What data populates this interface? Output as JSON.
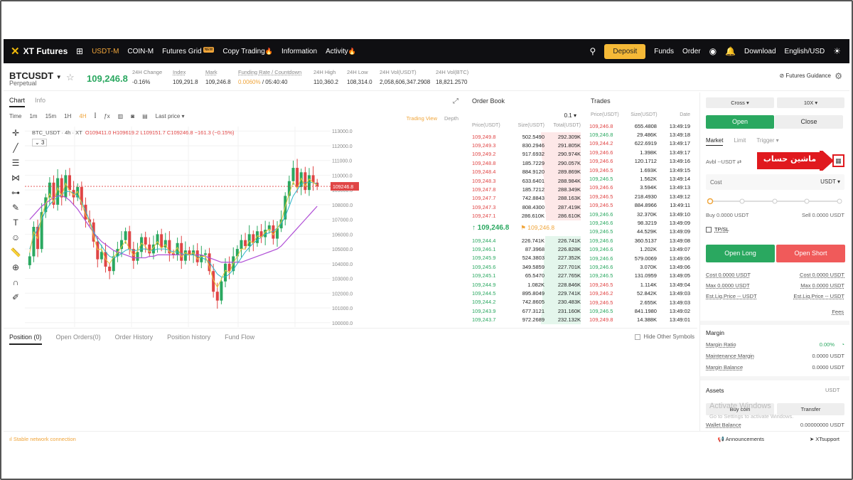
{
  "topnav": {
    "logo": "XT Futures",
    "items": [
      "USDT-M",
      "COIN-M",
      "Futures Grid",
      "Copy Trading",
      "Information",
      "Activity"
    ],
    "grid_badge": "NEW",
    "deposit": "Deposit",
    "funds": "Funds",
    "order": "Order",
    "download": "Download",
    "lang": "English/USD"
  },
  "header": {
    "symbol": "BTCUSDT",
    "type": "Perpetual",
    "last_price": "109,246.8",
    "stats": [
      {
        "label": "24H Change",
        "value": "-0.16%"
      },
      {
        "label": "Index",
        "value": "109,291.8"
      },
      {
        "label": "Mark",
        "value": "109,246.8"
      },
      {
        "label": "Funding Rate / Countdown",
        "value": "0.0060%",
        "value2": "05:40:40"
      },
      {
        "label": "24H High",
        "value": "110,360.2"
      },
      {
        "label": "24H Low",
        "value": "108,314.0"
      },
      {
        "label": "24H Vol(USDT)",
        "value": "2,058,606,347.2908"
      },
      {
        "label": "24H Vol(BTC)",
        "value": "18,821.2570"
      }
    ],
    "guidance": "Futures Guidance"
  },
  "chart": {
    "tabs": [
      "Chart",
      "Info"
    ],
    "intervals": [
      "Time",
      "1m",
      "15m",
      "1H",
      "4H"
    ],
    "last_price_label": "Last price",
    "view_tv": "Trading View",
    "view_depth": "Depth",
    "legend_title": "BTC_USDT · 4h · XT",
    "legend_values": "O109411.0 H109619.2 L109151.7 C109246.8 −161.3 (−0.15%)",
    "indicator_count": "3",
    "price_tag": "109246.8",
    "axis_labels": [
      "113000.0",
      "112000.0",
      "111000.0",
      "110000.0",
      "109000.0",
      "108000.0",
      "107000.0",
      "106000.0",
      "105000.0",
      "104000.0",
      "103000.0",
      "102000.0",
      "101000.0",
      "100000.0"
    ]
  },
  "chart_data": {
    "type": "candlestick",
    "title": "BTC_USDT · 4h · XT",
    "ylim": [
      99700,
      113300
    ],
    "closes": [
      104500,
      106500,
      105000,
      107500,
      108500,
      109500,
      108000,
      109800,
      108500,
      110000,
      109000,
      108500,
      109200,
      108000,
      107000,
      106800,
      105500,
      104300,
      104800,
      103800,
      103500,
      104500,
      105000,
      105600,
      106200,
      105000,
      104200,
      104800,
      105800,
      105300,
      104700,
      105300,
      106000,
      105100,
      105600,
      104700,
      104600,
      105400,
      104200,
      104900,
      104600,
      104900,
      104100,
      104600,
      104700,
      103500,
      102100,
      101500,
      102800,
      104000,
      103500,
      104500,
      105000,
      105600,
      105200,
      106000,
      105400,
      106200,
      105800,
      106300,
      106600,
      105700,
      106400,
      107000,
      108600,
      109600,
      110500,
      109200,
      110200,
      109000,
      110000,
      109500,
      109246.8
    ],
    "ma_fast": [
      105000,
      105800,
      106400,
      107000,
      107600,
      108000,
      108300,
      108500,
      108700,
      108900,
      108900,
      108800,
      108600,
      108200,
      107600,
      106900,
      106200,
      105600,
      105200,
      104800,
      104500,
      104400,
      104500,
      104700,
      104900,
      105000,
      104900,
      104900,
      105000,
      105000,
      104900,
      104900,
      105000,
      105000,
      105000,
      104900,
      104800,
      104800,
      104700,
      104600,
      104600,
      104600,
      104500,
      104400,
      104300,
      104100,
      103700,
      103300,
      103100,
      103100,
      103300,
      103600,
      104000,
      104400,
      104800,
      105100,
      105400,
      105600,
      105800,
      106000,
      106100,
      106200,
      106400,
      106700,
      107200,
      107900,
      108600,
      109000,
      109400,
      109500,
      109500,
      109500,
      109400
    ],
    "ma_slow": [
      107000,
      107300,
      107600,
      107900,
      108100,
      108300,
      108500,
      108600,
      108600,
      108500,
      108300,
      108000,
      107700,
      107300,
      106900,
      106500,
      106100,
      105800,
      105500,
      105300,
      105100,
      104900,
      104800,
      104700,
      104600,
      104500,
      104400,
      104400,
      104400,
      104400,
      104500,
      104500,
      104600,
      104600,
      104600,
      104600,
      104600,
      104600,
      104600,
      104600,
      104600,
      104600,
      104600,
      104600,
      104500,
      104400,
      104300,
      104200,
      104100,
      104100,
      104100,
      104100,
      104100,
      104100,
      104200,
      104300,
      104400,
      104500,
      104600,
      104700,
      104800,
      104900,
      105000,
      105200,
      105500,
      105800,
      106100,
      106400,
      106700,
      107000,
      107300,
      107600,
      107900
    ]
  },
  "orderbook": {
    "title": "Order Book",
    "precision": "0.1",
    "cols": [
      "Price(USDT)",
      "Size(USDT)",
      "Total(USDT)"
    ],
    "asks": [
      [
        "109,249.8",
        "502.5490",
        "292.309K"
      ],
      [
        "109,249.3",
        "830.2946",
        "291.805K"
      ],
      [
        "109,249.2",
        "917.6932",
        "290.974K"
      ],
      [
        "109,248.8",
        "185.7229",
        "290.057K"
      ],
      [
        "109,248.4",
        "884.9120",
        "289.869K"
      ],
      [
        "109,248.3",
        "633.6401",
        "288.984K"
      ],
      [
        "109,247.8",
        "185.7212",
        "288.349K"
      ],
      [
        "109,247.7",
        "742.8843",
        "288.163K"
      ],
      [
        "109,247.3",
        "808.4300",
        "287.419K"
      ],
      [
        "109,247.1",
        "286.610K",
        "286.610K"
      ]
    ],
    "ask_depth": [
      1.0,
      0.99,
      0.98,
      0.96,
      0.95,
      0.93,
      0.92,
      0.91,
      0.9,
      0.88
    ],
    "mid_price": "↑ 109,246.8",
    "mark_price": "109,246.8",
    "bids": [
      [
        "109,244.4",
        "226.741K",
        "226.741K"
      ],
      [
        "109,246.1",
        "87.3968",
        "226.828K"
      ],
      [
        "109,245.9",
        "524.3803",
        "227.352K"
      ],
      [
        "109,245.6",
        "349.5859",
        "227.701K"
      ],
      [
        "109,245.1",
        "65.5470",
        "227.765K"
      ],
      [
        "109,244.9",
        "1.082K",
        "228.846K"
      ],
      [
        "109,244.5",
        "895.8049",
        "229.741K"
      ],
      [
        "109,244.2",
        "742.8605",
        "230.483K"
      ],
      [
        "109,243.9",
        "677.3121",
        "231.160K"
      ],
      [
        "109,243.7",
        "972.2689",
        "232.132K"
      ]
    ],
    "bid_depth": [
      0.9,
      0.91,
      0.92,
      0.93,
      0.94,
      0.95,
      0.96,
      0.97,
      0.98,
      1.0
    ]
  },
  "trades": {
    "title": "Trades",
    "cols": [
      "Price(USDT)",
      "Size(USDT)",
      "Date"
    ],
    "rows": [
      [
        "109,246.8",
        "655.4808",
        "13:49:19",
        "r"
      ],
      [
        "109,246.8",
        "29.486K",
        "13:49:18",
        "g"
      ],
      [
        "109,244.2",
        "622.6919",
        "13:49:17",
        "r"
      ],
      [
        "109,246.6",
        "1.398K",
        "13:49:17",
        "r"
      ],
      [
        "109,246.6",
        "120.1712",
        "13:49:16",
        "r"
      ],
      [
        "109,246.5",
        "1.693K",
        "13:49:15",
        "r"
      ],
      [
        "109,246.5",
        "1.562K",
        "13:49:14",
        "g"
      ],
      [
        "109,246.6",
        "3.594K",
        "13:49:13",
        "r"
      ],
      [
        "109,246.5",
        "218.4930",
        "13:49:12",
        "r"
      ],
      [
        "109,246.5",
        "884.8966",
        "13:49:11",
        "r"
      ],
      [
        "109,246.6",
        "32.370K",
        "13:49:10",
        "g"
      ],
      [
        "109,246.6",
        "98.3219",
        "13:49:09",
        "g"
      ],
      [
        "109,246.5",
        "44.529K",
        "13:49:09",
        "g"
      ],
      [
        "109,246.6",
        "360.5137",
        "13:49:08",
        "g"
      ],
      [
        "109,246.6",
        "1.202K",
        "13:49:07",
        "g"
      ],
      [
        "109,246.6",
        "579.0069",
        "13:49:06",
        "g"
      ],
      [
        "109,246.6",
        "3.070K",
        "13:49:06",
        "g"
      ],
      [
        "109,246.5",
        "131.0959",
        "13:49:05",
        "g"
      ],
      [
        "109,246.5",
        "1.114K",
        "13:49:04",
        "r"
      ],
      [
        "109,246.2",
        "52.842K",
        "13:49:03",
        "r"
      ],
      [
        "109,246.5",
        "2.655K",
        "13:49:03",
        "r"
      ],
      [
        "109,246.5",
        "841.1980",
        "13:49:02",
        "g"
      ],
      [
        "109,249.8",
        "14.388K",
        "13:49:01",
        "r"
      ]
    ]
  },
  "bottom": {
    "tabs": [
      "Position (0)",
      "Open Orders(0)",
      "Order History",
      "Position history",
      "Fund Flow"
    ],
    "hide_other": "Hide Other Symbols",
    "connection": "Stable network connection",
    "announcements": "Announcements",
    "support": "XTsupport"
  },
  "sidebar": {
    "margin_mode": "Cross",
    "leverage": "10X",
    "open": "Open",
    "close": "Close",
    "order_types": [
      "Market",
      "Limit",
      "Trigger"
    ],
    "avbl": "Avbl --USDT",
    "callout": "ماشین حساب",
    "cost_label": "Cost",
    "cost_unit": "USDT",
    "buy": "Buy 0.0000 USDT",
    "sell": "Sell 0.0000 USDT",
    "tpsl": "TP/SL",
    "open_long": "Open Long",
    "open_short": "Open Short",
    "cost_l": "Cost 0.0000 USDT",
    "cost_r": "Cost 0.0000 USDT",
    "max_l": "Max 0.0000 USDT",
    "max_r": "Max 0.0000 USDT",
    "liq_l": "Est.Liq.Price -- USDT",
    "liq_r": "Est.Liq.Price -- USDT",
    "fees": "Fees",
    "margin_title": "Margin",
    "margin_ratio_label": "Margin Ratio",
    "margin_ratio_value": "0.00%",
    "maint_label": "Maintenance Margin",
    "maint_value": "0.0000 USDT",
    "balance_label": "Margin Balance",
    "balance_value": "0.0000 USDT",
    "assets_title": "Assets",
    "assets_unit": "USDT",
    "buy_coin": "Buy coin",
    "transfer": "Transfer",
    "wallet_label": "Wallet Balance",
    "wallet_value": "0.00000000 USDT",
    "watermark1": "Activate Windows",
    "watermark2": "Go to Settings to activate Windows."
  },
  "colors": {
    "up": "#2aa860",
    "down": "#e04545",
    "accent": "#f0a53a"
  }
}
